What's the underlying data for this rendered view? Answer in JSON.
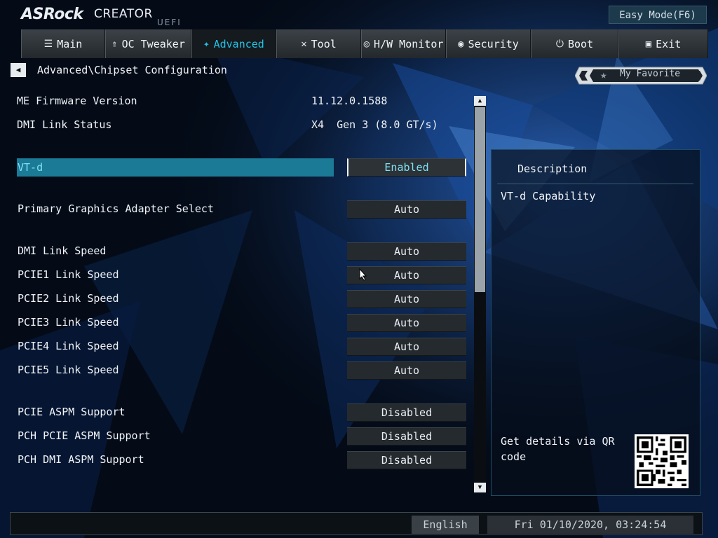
{
  "header": {
    "brand": "ASRock",
    "product": "CREATOR",
    "firmware": "UEFI",
    "easy_mode_label": "Easy Mode(F6)"
  },
  "tabs": [
    {
      "label": "Main",
      "icon": "list-icon",
      "active": false
    },
    {
      "label": "OC Tweaker",
      "icon": "rocket-icon",
      "active": false
    },
    {
      "label": "Advanced",
      "icon": "star-icon",
      "active": true
    },
    {
      "label": "Tool",
      "icon": "wrench-icon",
      "active": false
    },
    {
      "label": "H/W Monitor",
      "icon": "monitor-icon",
      "active": false
    },
    {
      "label": "Security",
      "icon": "shield-icon",
      "active": false
    },
    {
      "label": "Boot",
      "icon": "power-icon",
      "active": false
    },
    {
      "label": "Exit",
      "icon": "exit-icon",
      "active": false
    }
  ],
  "breadcrumb": "Advanced\\Chipset Configuration",
  "favorite_label": "My Favorite",
  "info": [
    {
      "label": "ME Firmware Version",
      "value": "11.12.0.1588"
    },
    {
      "label": "DMI Link Status",
      "value": "X4  Gen 3 (8.0 GT/s)"
    }
  ],
  "settings": [
    {
      "label": "VT-d",
      "value": "Enabled",
      "selected": true
    },
    {
      "label": "Primary Graphics Adapter Select",
      "value": "Auto"
    },
    {
      "label": "DMI Link Speed",
      "value": "Auto"
    },
    {
      "label": "PCIE1 Link Speed",
      "value": "Auto"
    },
    {
      "label": "PCIE2 Link Speed",
      "value": "Auto"
    },
    {
      "label": "PCIE3 Link Speed",
      "value": "Auto"
    },
    {
      "label": "PCIE4 Link Speed",
      "value": "Auto"
    },
    {
      "label": "PCIE5 Link Speed",
      "value": "Auto"
    },
    {
      "label": "PCIE ASPM Support",
      "value": "Disabled"
    },
    {
      "label": "PCH PCIE ASPM Support",
      "value": "Disabled"
    },
    {
      "label": "PCH DMI ASPM Support",
      "value": "Disabled"
    }
  ],
  "description": {
    "title": "Description",
    "text": "VT-d Capability",
    "qr_text": "Get details via QR code"
  },
  "footer": {
    "language": "English",
    "datetime": "Fri 01/10/2020, 03:24:54"
  },
  "colors": {
    "accent": "#22c3e6",
    "selection": "#1b7a96"
  }
}
